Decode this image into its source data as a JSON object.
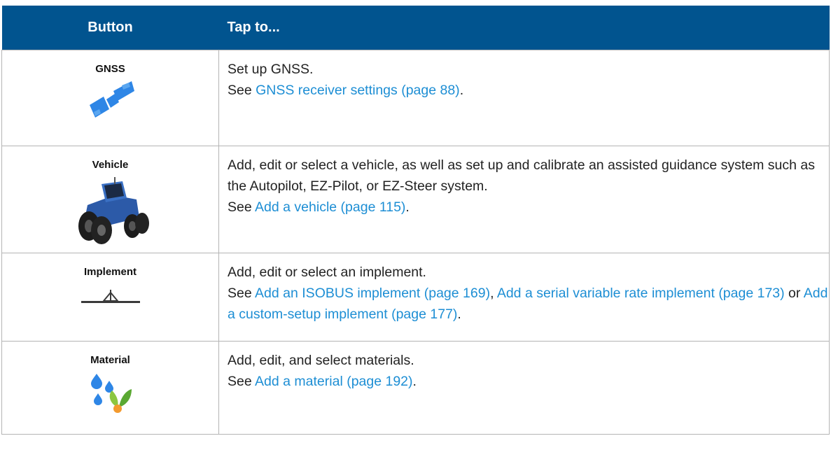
{
  "table": {
    "headers": [
      "Button",
      "Tap to..."
    ],
    "rows": [
      {
        "button_label": "GNSS",
        "icon": "satellite-icon",
        "lines": [
          {
            "text": "Set up GNSS."
          },
          {
            "prefix": "See ",
            "link": "GNSS receiver settings (page 88)",
            "suffix": "."
          }
        ]
      },
      {
        "button_label": "Vehicle",
        "icon": "tractor-icon",
        "lines": [
          {
            "text": "Add, edit or select a vehicle, as well as set up and calibrate an assisted guidance system such as the Autopilot, EZ-Pilot, or EZ-Steer system."
          },
          {
            "prefix": "See ",
            "link": "Add a vehicle (page 115)",
            "suffix": "."
          }
        ]
      },
      {
        "button_label": "Implement",
        "icon": "implement-icon",
        "lines": [
          {
            "text": "Add, edit or select an implement."
          },
          {
            "prefix": "See ",
            "link1": "Add an ISOBUS implement (page 169)",
            "sep1": ", ",
            "link2": "Add a serial variable rate implement (page 173)",
            "sep2": " or ",
            "link3": "Add a custom-setup implement (page 177)",
            "suffix": "."
          }
        ]
      },
      {
        "button_label": "Material",
        "icon": "material-icon",
        "lines": [
          {
            "text": "Add, edit, and select materials."
          },
          {
            "prefix": "See ",
            "link": "Add a material (page 192)",
            "suffix": "."
          }
        ]
      }
    ]
  }
}
